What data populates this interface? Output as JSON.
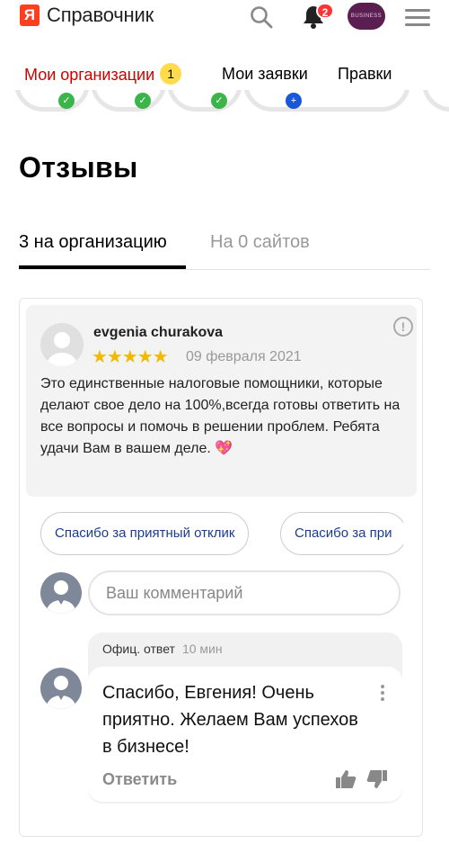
{
  "header": {
    "logo_letter": "Я",
    "app_name": "Справочник",
    "notifications_count": "2",
    "business_avatar_text": "BUSINESS"
  },
  "nav": {
    "tabs": [
      {
        "label": "Мои организации",
        "count": "1",
        "active": true
      },
      {
        "label": "Мои заявки",
        "active": false
      },
      {
        "label": "Правки",
        "active": false
      }
    ]
  },
  "reviews": {
    "title": "Отзывы",
    "tabs": [
      {
        "label": "3 на организацию",
        "active": true
      },
      {
        "label": "На 0 сайтов",
        "active": false
      }
    ],
    "review": {
      "author": "evgenia churakova",
      "rating": 5,
      "stars": "★★★★★",
      "date": "09 февраля 2021",
      "text": "Это единственные налоговые помощники, которые делают свое дело на 100%,всегда готовы ответить на все вопросы и помочь в решении проблем. Ребята удачи Вам в вашем деле. 💖"
    },
    "quick_replies": [
      "Спасибо за приятный отклик",
      "Спасибо за при"
    ],
    "comment_placeholder": "Ваш комментарий",
    "official_reply": {
      "label": "Офиц. ответ",
      "time": "10 мин",
      "text": "Спасибо, Евгения! Очень приятно. Желаем Вам успехов в бизнесе!",
      "reply_label": "Ответить"
    }
  },
  "colors": {
    "brand_red": "#fc3f1d",
    "active_nav": "#cc0000",
    "badge_yellow": "#ffdb4d",
    "star": "#f5b800",
    "link_blue": "#1b3c8f"
  }
}
